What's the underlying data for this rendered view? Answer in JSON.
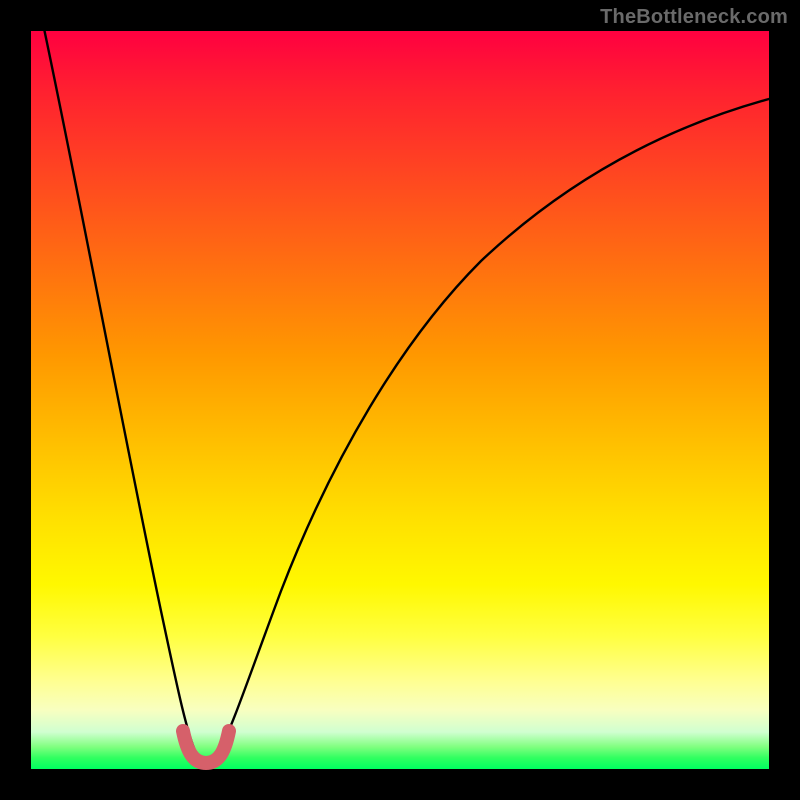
{
  "watermark": {
    "text": "TheBottleneck.com"
  },
  "chart_data": {
    "type": "line",
    "title": "",
    "xlabel": "",
    "ylabel": "",
    "xlim": [
      0,
      100
    ],
    "ylim": [
      0,
      100
    ],
    "grid": false,
    "legend": false,
    "description": "V-shaped bottleneck curve on red-to-green vertical gradient. Curve reaches minimum near x≈22 at y≈0, rising steeply on both sides.",
    "background_gradient_stops": [
      {
        "pos": 0,
        "color": "#ff0040"
      },
      {
        "pos": 50,
        "color": "#ffb000"
      },
      {
        "pos": 82,
        "color": "#ffff60"
      },
      {
        "pos": 95,
        "color": "#c0ffc0"
      },
      {
        "pos": 100,
        "color": "#00ff60"
      }
    ],
    "series": [
      {
        "name": "bottleneck-curve",
        "color": "#000000",
        "x": [
          0,
          2,
          4,
          6,
          8,
          10,
          12,
          14,
          16,
          18,
          19,
          20,
          21,
          22,
          23,
          24,
          25,
          26,
          28,
          30,
          34,
          40,
          48,
          58,
          70,
          84,
          100
        ],
        "y": [
          105,
          95,
          85,
          75,
          65,
          55,
          45,
          35,
          25,
          14,
          9,
          5,
          2,
          1,
          1,
          2,
          4,
          7,
          13,
          19,
          30,
          42,
          54,
          64,
          72,
          78,
          82
        ]
      },
      {
        "name": "valley-highlight",
        "color": "#d6606a",
        "x": [
          19,
          20,
          21,
          22,
          23,
          24,
          25
        ],
        "y": [
          6,
          3,
          1.5,
          1,
          1.5,
          3,
          6
        ]
      }
    ]
  }
}
